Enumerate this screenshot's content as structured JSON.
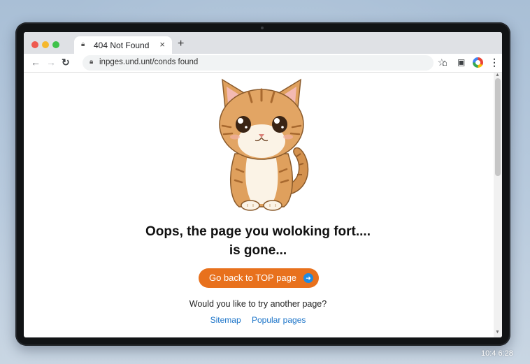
{
  "browser": {
    "tab": {
      "title": "404 Not Found",
      "close_label": "×"
    },
    "new_tab_label": "+",
    "address": {
      "url": "inpges.und.unt/conds found"
    }
  },
  "page": {
    "headline_line1": "Oops, the page you woloking fort....",
    "headline_line2": "is gone...",
    "cta_label": "Go back to TOP page",
    "prompt": "Would you like to try another page?",
    "links": [
      "Sitemap",
      "Popular pages"
    ]
  },
  "desktop": {
    "clock": "10:4 6:28"
  },
  "icons": {
    "tab": "lock-icon",
    "toolbar": [
      "back-arrow-icon",
      "forward-arrow-icon",
      "reload-icon",
      "lock-icon",
      "star-icon",
      "home-icon",
      "extension-icon",
      "profile-icon",
      "menu-icon"
    ],
    "cta": "arrow-right-icon",
    "illustration": "cat-illustration"
  },
  "colors": {
    "cta": "#e8711d",
    "cta_icon": "#1f8be0",
    "link": "#1a73c8",
    "traffic_lights": [
      "#ee5a50",
      "#f5b82e",
      "#3fc24a"
    ]
  }
}
